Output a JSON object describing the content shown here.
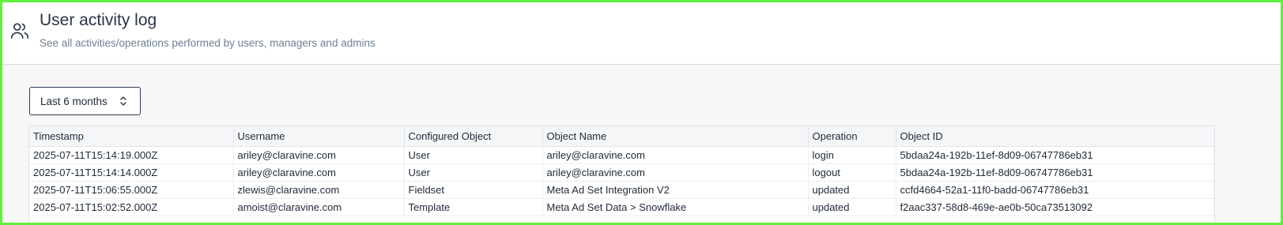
{
  "header": {
    "icon": "users-icon",
    "title": "User activity log",
    "subtitle": "See all activities/operations performed by users, managers and admins"
  },
  "filter": {
    "range_label": "Last 6 months",
    "range_icon": "chevron-up-down-icon"
  },
  "table": {
    "columns": [
      "Timestamp",
      "Username",
      "Configured Object",
      "Object Name",
      "Operation",
      "Object ID"
    ],
    "rows": [
      [
        "2025-07-11T15:14:19.000Z",
        "ariley@claravine.com",
        "User",
        "ariley@claravine.com",
        "login",
        "5bdaa24a-192b-11ef-8d09-06747786eb31"
      ],
      [
        "2025-07-11T15:14:14.000Z",
        "ariley@claravine.com",
        "User",
        "ariley@claravine.com",
        "logout",
        "5bdaa24a-192b-11ef-8d09-06747786eb31"
      ],
      [
        "2025-07-11T15:06:55.000Z",
        "zlewis@claravine.com",
        "Fieldset",
        "Meta Ad Set Integration V2",
        "updated",
        "ccfd4664-52a1-11f0-badd-06747786eb31"
      ],
      [
        "2025-07-11T15:02:52.000Z",
        "amoist@claravine.com",
        "Template",
        "Meta Ad Set Data > Snowflake",
        "updated",
        "f2aac337-58d8-469e-ae0b-50ca73513092"
      ]
    ]
  }
}
